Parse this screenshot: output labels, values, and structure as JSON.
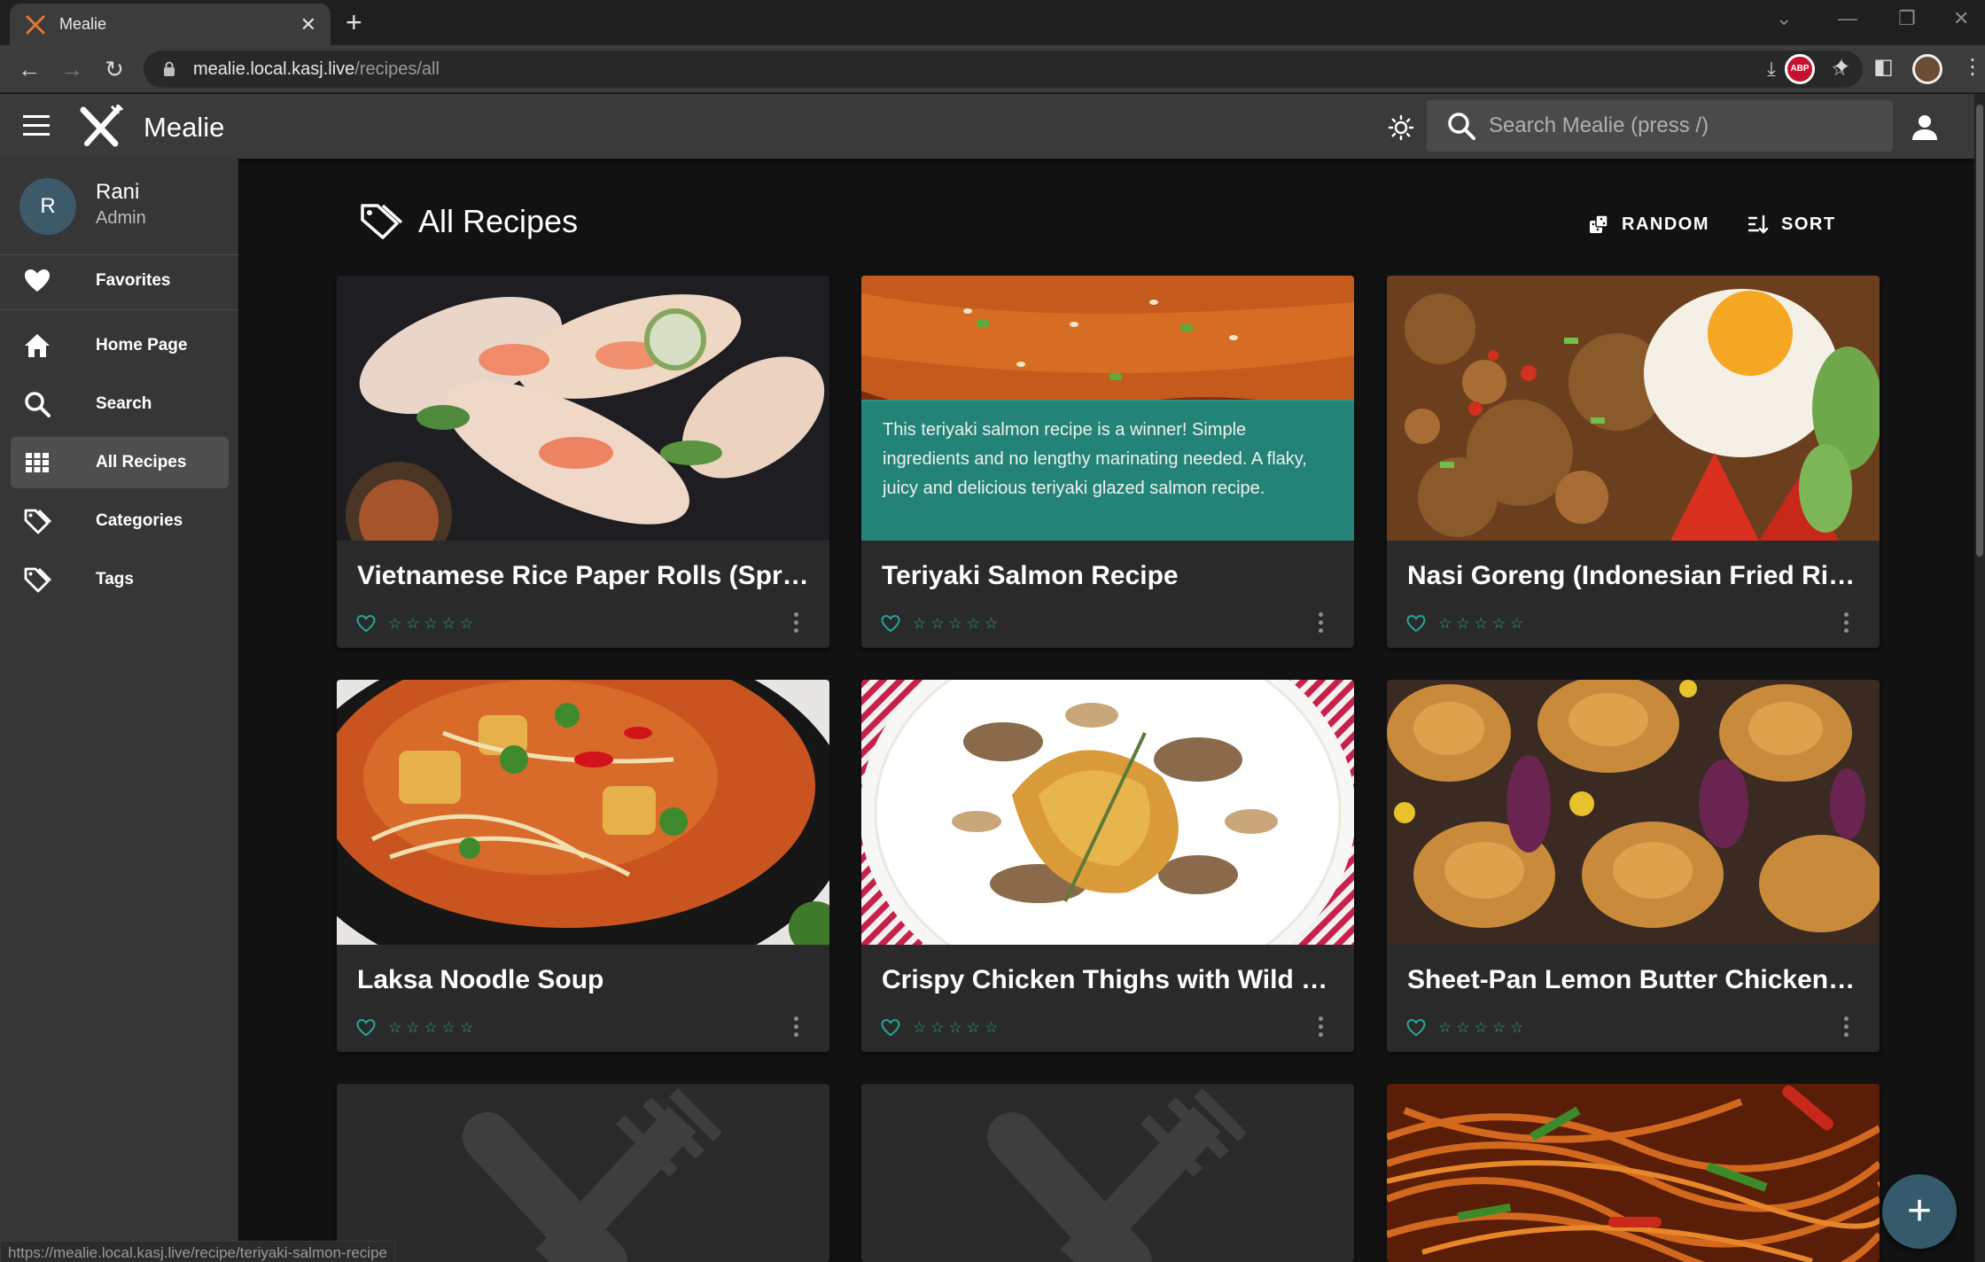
{
  "browser": {
    "tab_title": "Mealie",
    "url_host": "mealie.local.kasj.live",
    "url_path": "/recipes/all",
    "status_url": "https://mealie.local.kasj.live/recipe/teriyaki-salmon-recipe"
  },
  "appbar": {
    "title": "Mealie",
    "search_placeholder": "Search Mealie (press /)"
  },
  "sidebar": {
    "user_initial": "R",
    "user_name": "Rani",
    "user_role": "Admin",
    "items": [
      {
        "label": "Favorites",
        "icon": "heart-icon"
      },
      {
        "label": "Home Page",
        "icon": "home-icon"
      },
      {
        "label": "Search",
        "icon": "search-icon"
      },
      {
        "label": "All Recipes",
        "icon": "grid-icon",
        "active": true
      },
      {
        "label": "Categories",
        "icon": "tags-icon"
      },
      {
        "label": "Tags",
        "icon": "tags-icon"
      }
    ]
  },
  "main": {
    "page_title": "All Recipes",
    "random_label": "RANDOM",
    "sort_label": "SORT",
    "recipes": [
      {
        "title": "Vietnamese Rice Paper Rolls (Sprin...",
        "rating": 0
      },
      {
        "title": "Teriyaki Salmon Recipe",
        "rating": 0,
        "description": "This teriyaki salmon recipe is a winner! Simple ingredients and no lengthy marinating needed. A flaky, juicy and delicious teriyaki glazed salmon recipe."
      },
      {
        "title": "Nasi Goreng (Indonesian Fried Rice)",
        "rating": 0
      },
      {
        "title": "Laksa Noodle Soup",
        "rating": 0
      },
      {
        "title": "Crispy Chicken Thighs with Wild M...",
        "rating": 0
      },
      {
        "title": "Sheet-Pan Lemon Butter Chicken T...",
        "rating": 0
      }
    ],
    "stars": "☆☆☆☆☆"
  },
  "colors": {
    "accent": "#26a69a",
    "appbar": "#3a3a3a",
    "sidebar": "#363636",
    "background": "#121212",
    "card": "#2a2a2a",
    "fab": "#355a6b"
  }
}
